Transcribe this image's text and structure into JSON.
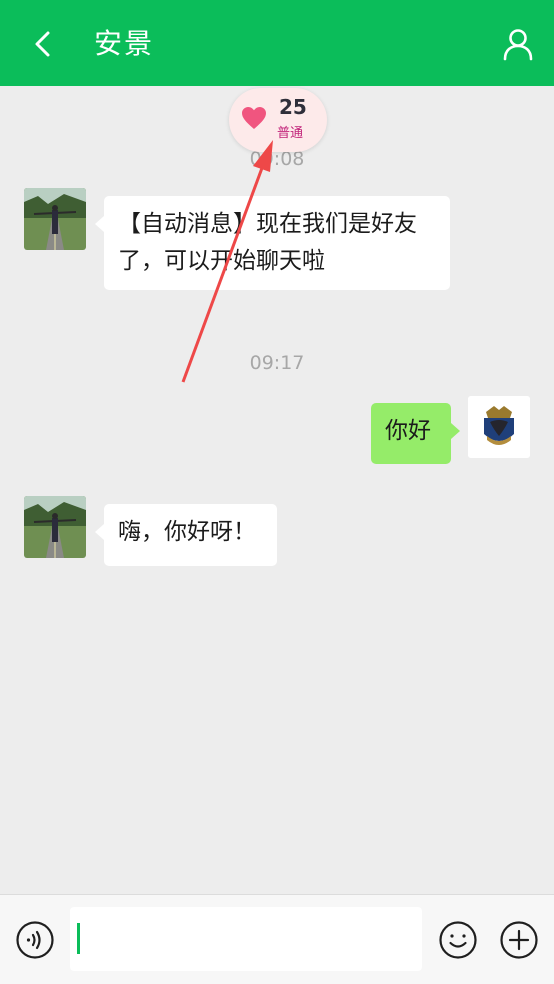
{
  "header": {
    "title": "安景",
    "back_icon": "chevron-left-icon",
    "profile_icon": "user-icon",
    "bg_color": "#0bbd5a"
  },
  "intimacy_badge": {
    "score": "25",
    "level": "普通",
    "icon": "heart-icon",
    "accent": "#f0557f"
  },
  "messages": [
    {
      "time": "09:08",
      "side": "left",
      "text": "【自动消息】现在我们是好友了，可以开始聊天啦"
    },
    {
      "time": "09:17",
      "side": "right",
      "text": "你好"
    },
    {
      "side": "left",
      "text": "嗨，你好呀！"
    }
  ],
  "input_bar": {
    "value": "",
    "voice_icon": "voice-icon",
    "emoji_icon": "smiley-icon",
    "plus_icon": "plus-icon"
  }
}
